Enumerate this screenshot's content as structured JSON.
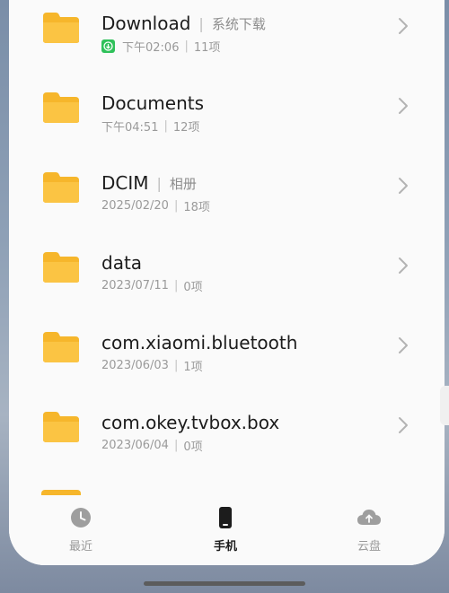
{
  "folders": [
    {
      "name": "Download",
      "alias": "系统下载",
      "time": "下午02:06",
      "count": "11项",
      "badge": true
    },
    {
      "name": "Documents",
      "alias": "",
      "time": "下午04:51",
      "count": "12项",
      "badge": false
    },
    {
      "name": "DCIM",
      "alias": "相册",
      "time": "2025/02/20",
      "count": "18项",
      "badge": false
    },
    {
      "name": "data",
      "alias": "",
      "time": "2023/07/11",
      "count": "0项",
      "badge": false
    },
    {
      "name": "com.xiaomi.bluetooth",
      "alias": "",
      "time": "2023/06/03",
      "count": "1项",
      "badge": false
    },
    {
      "name": "com.okey.tvbox.box",
      "alias": "",
      "time": "2023/06/04",
      "count": "0项",
      "badge": false
    }
  ],
  "tabs": {
    "recent": "最近",
    "phone": "手机",
    "cloud": "云盘"
  },
  "colors": {
    "folder": "#f6b62b",
    "badge": "#2fc15a"
  }
}
